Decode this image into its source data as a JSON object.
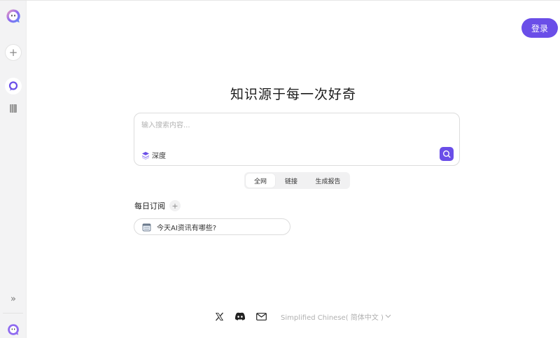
{
  "sidebar": {
    "logo_icon": "chat-bubble-logo-icon",
    "new_label": "+",
    "expand_label": "»"
  },
  "header": {
    "login_label": "登录"
  },
  "main": {
    "headline": "知识源于每一次好奇",
    "search": {
      "placeholder": "输入搜索内容...",
      "depth_label": "深度"
    },
    "tabs": [
      {
        "label": "全网",
        "active": true
      },
      {
        "label": "链接",
        "active": false
      },
      {
        "label": "生成报告",
        "active": false
      }
    ],
    "daily": {
      "title": "每日订阅",
      "add_label": "+",
      "items": [
        {
          "label": "今天AI资讯有哪些?"
        }
      ]
    }
  },
  "footer": {
    "language_label": "Simplified Chinese( 简体中文 )",
    "icons": [
      "x-icon",
      "discord-icon",
      "mail-icon"
    ]
  },
  "colors": {
    "accent": "#6a4ee8",
    "sidebar_bg": "#f3f3f4"
  }
}
